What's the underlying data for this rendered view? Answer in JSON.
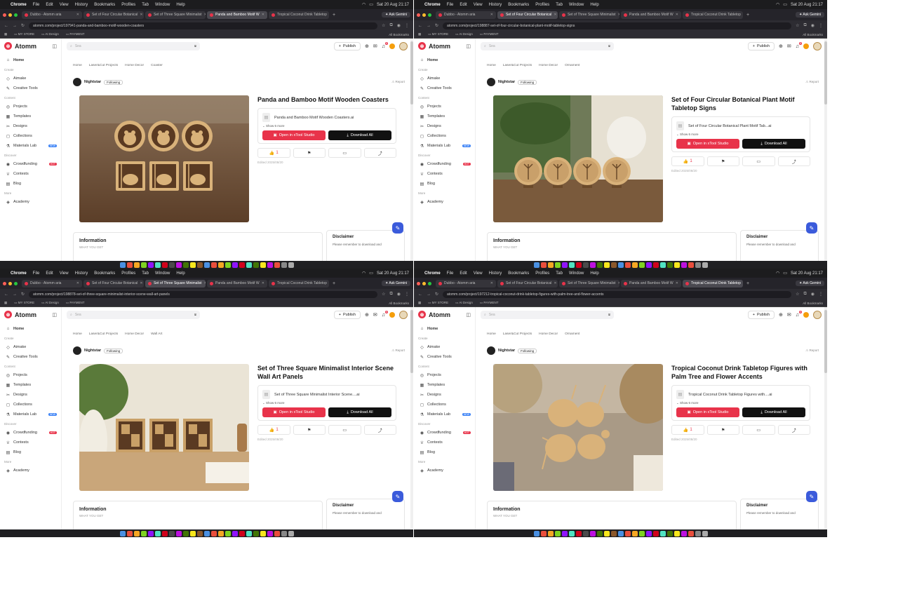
{
  "menubar": {
    "apple": "",
    "app": "Chrome",
    "items": [
      "File",
      "Edit",
      "View",
      "History",
      "Bookmarks",
      "Profiles",
      "Tab",
      "Window",
      "Help"
    ],
    "clock": "Sat 20 Aug  21:17"
  },
  "browser": {
    "ask_gemini": "✦ Ask Gemini",
    "bookmarks": [
      "MY STORE",
      "AI Design",
      "PAYMENT"
    ],
    "all_bookmarks": "All Bookmarks"
  },
  "tabs": [
    "Dubbo - Atomm aria",
    "Set of Four Circular Botanical",
    "Set of Three Square Minimalist",
    "Panda and Bamboo Motif W",
    "Tropical Coconut Drink Tabletop"
  ],
  "app": {
    "brand": "Atomm",
    "search_placeholder": "Sea",
    "publish_label": "Publish",
    "notif_count": "6",
    "sections": {
      "create": "Create",
      "content": "Content",
      "discover": "Discover",
      "more": "More"
    },
    "nav": {
      "home": "Home",
      "aimake": "Aimake",
      "creative_tools": "Creative Tools",
      "projects": "Projects",
      "templates": "Templates",
      "designs": "Designs",
      "collections": "Collections",
      "materials_lab": "Materials Lab",
      "crowdfunding": "Crowdfunding",
      "contests": "Contests",
      "blog": "Blog",
      "academy": "Academy"
    },
    "badges": {
      "new": "NEW",
      "hot": "HOT"
    },
    "author": "Nightstar",
    "following": "Following",
    "report": "Report",
    "open_btn": "Open in xTool Studio",
    "download_btn": "Download All",
    "show_more": "Show 6 more",
    "like_count": "1",
    "information": "Information",
    "what_you_get": "WHAT YOU GET",
    "disclaimer": "Disclaimer",
    "disclaimer_text": "Please remember to download and"
  },
  "windows": [
    {
      "url": "atomm.com/project/197941-panda-and-bamboo-motif-wooden-coasters",
      "active_tab": 3,
      "crumbs": [
        "Home",
        "Laser&Cut Projects",
        "Home Decor",
        "Coaster"
      ],
      "title": "Panda and Bamboo Motif Wooden Coasters",
      "file": "Panda and Bamboo Motif Wooden Coasters.ai",
      "edited": "Edited 2025/08/20"
    },
    {
      "url": "atomm.com/project/198887-set-of-four-circular-botanical-plant-motif-tabletop-signs",
      "active_tab": 1,
      "crumbs": [
        "Home",
        "Laser&Cut Projects",
        "Home Decor",
        "Ornament"
      ],
      "title": "Set of Four Circular Botanical Plant Motif Tabletop Signs",
      "file": "Set of Four Circular Botanical Plant Motif Tab...ai",
      "edited": "Edited 2025/08/20"
    },
    {
      "url": "atomm.com/project/198878-set-of-three-square-minimalist-interior-scene-wall-art-panels",
      "active_tab": 2,
      "crumbs": [
        "Home",
        "Laser&Cut Projects",
        "Home Decor",
        "Wall Art"
      ],
      "title": "Set of Three Square Minimalist Interior Scene Wall Art Panels",
      "file": "Set of Three Square Minimalist Interior Scene....ai",
      "edited": "Edited 2025/08/20"
    },
    {
      "url": "atomm.com/project/197212-tropical-coconut-drink-tabletop-figures-with-palm-tree-and-flower-accents",
      "active_tab": 4,
      "crumbs": [
        "Home",
        "Laser&Cut Projects",
        "Home Decor",
        "Ornament"
      ],
      "title": "Tropical Coconut Drink Tabletop Figures with Palm Tree and Flower Accents",
      "file": "Tropical Coconut Drink Tabletop Figures with....ai",
      "edited": "Edited 2025/08/20"
    }
  ],
  "colors": {
    "brand": "#e8334a",
    "dark": "#111111",
    "link": "#3b5bdb"
  }
}
